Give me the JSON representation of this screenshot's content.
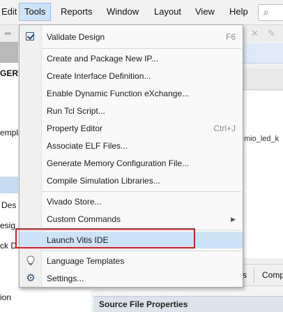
{
  "menubar": {
    "items": [
      {
        "label": "Edit"
      },
      {
        "label": "Tools"
      },
      {
        "label": "Reports"
      },
      {
        "label": "Window"
      },
      {
        "label": "Layout"
      },
      {
        "label": "View"
      },
      {
        "label": "Help"
      }
    ],
    "active_menu": "Tools",
    "search_icon": "search-icon"
  },
  "background": {
    "left_texts": [
      "GER",
      "empla",
      "Des",
      "esig",
      "ck D",
      "ion"
    ],
    "right_text": "mio_led_k",
    "tabs": [
      "s",
      "Comp"
    ],
    "source_props_title": "Source File Properties"
  },
  "tools_menu": {
    "items": [
      {
        "label": "Validate Design",
        "shortcut": "F6",
        "icon": "validate-check-icon"
      },
      {
        "label": "Create and Package New IP...",
        "shortcut": ""
      },
      {
        "label": "Create Interface Definition...",
        "shortcut": ""
      },
      {
        "label": "Enable Dynamic Function eXchange...",
        "shortcut": ""
      },
      {
        "label": "Run Tcl Script...",
        "shortcut": ""
      },
      {
        "label": "Property Editor",
        "shortcut": "Ctrl+J"
      },
      {
        "label": "Associate ELF Files...",
        "shortcut": ""
      },
      {
        "label": "Generate Memory Configuration File...",
        "shortcut": ""
      },
      {
        "label": "Compile Simulation Libraries...",
        "shortcut": ""
      },
      {
        "label": "Vivado Store...",
        "shortcut": ""
      },
      {
        "label": "Custom Commands",
        "shortcut": "",
        "submenu": true
      },
      {
        "label": "Launch Vitis IDE",
        "shortcut": "",
        "highlighted": true
      },
      {
        "label": "Language Templates",
        "shortcut": "",
        "icon": "lightbulb-icon"
      },
      {
        "label": "Settings...",
        "shortcut": "",
        "icon": "gear-icon"
      }
    ]
  },
  "colors": {
    "highlight": "#cde3f7",
    "annotation_box": "#e0171b"
  }
}
